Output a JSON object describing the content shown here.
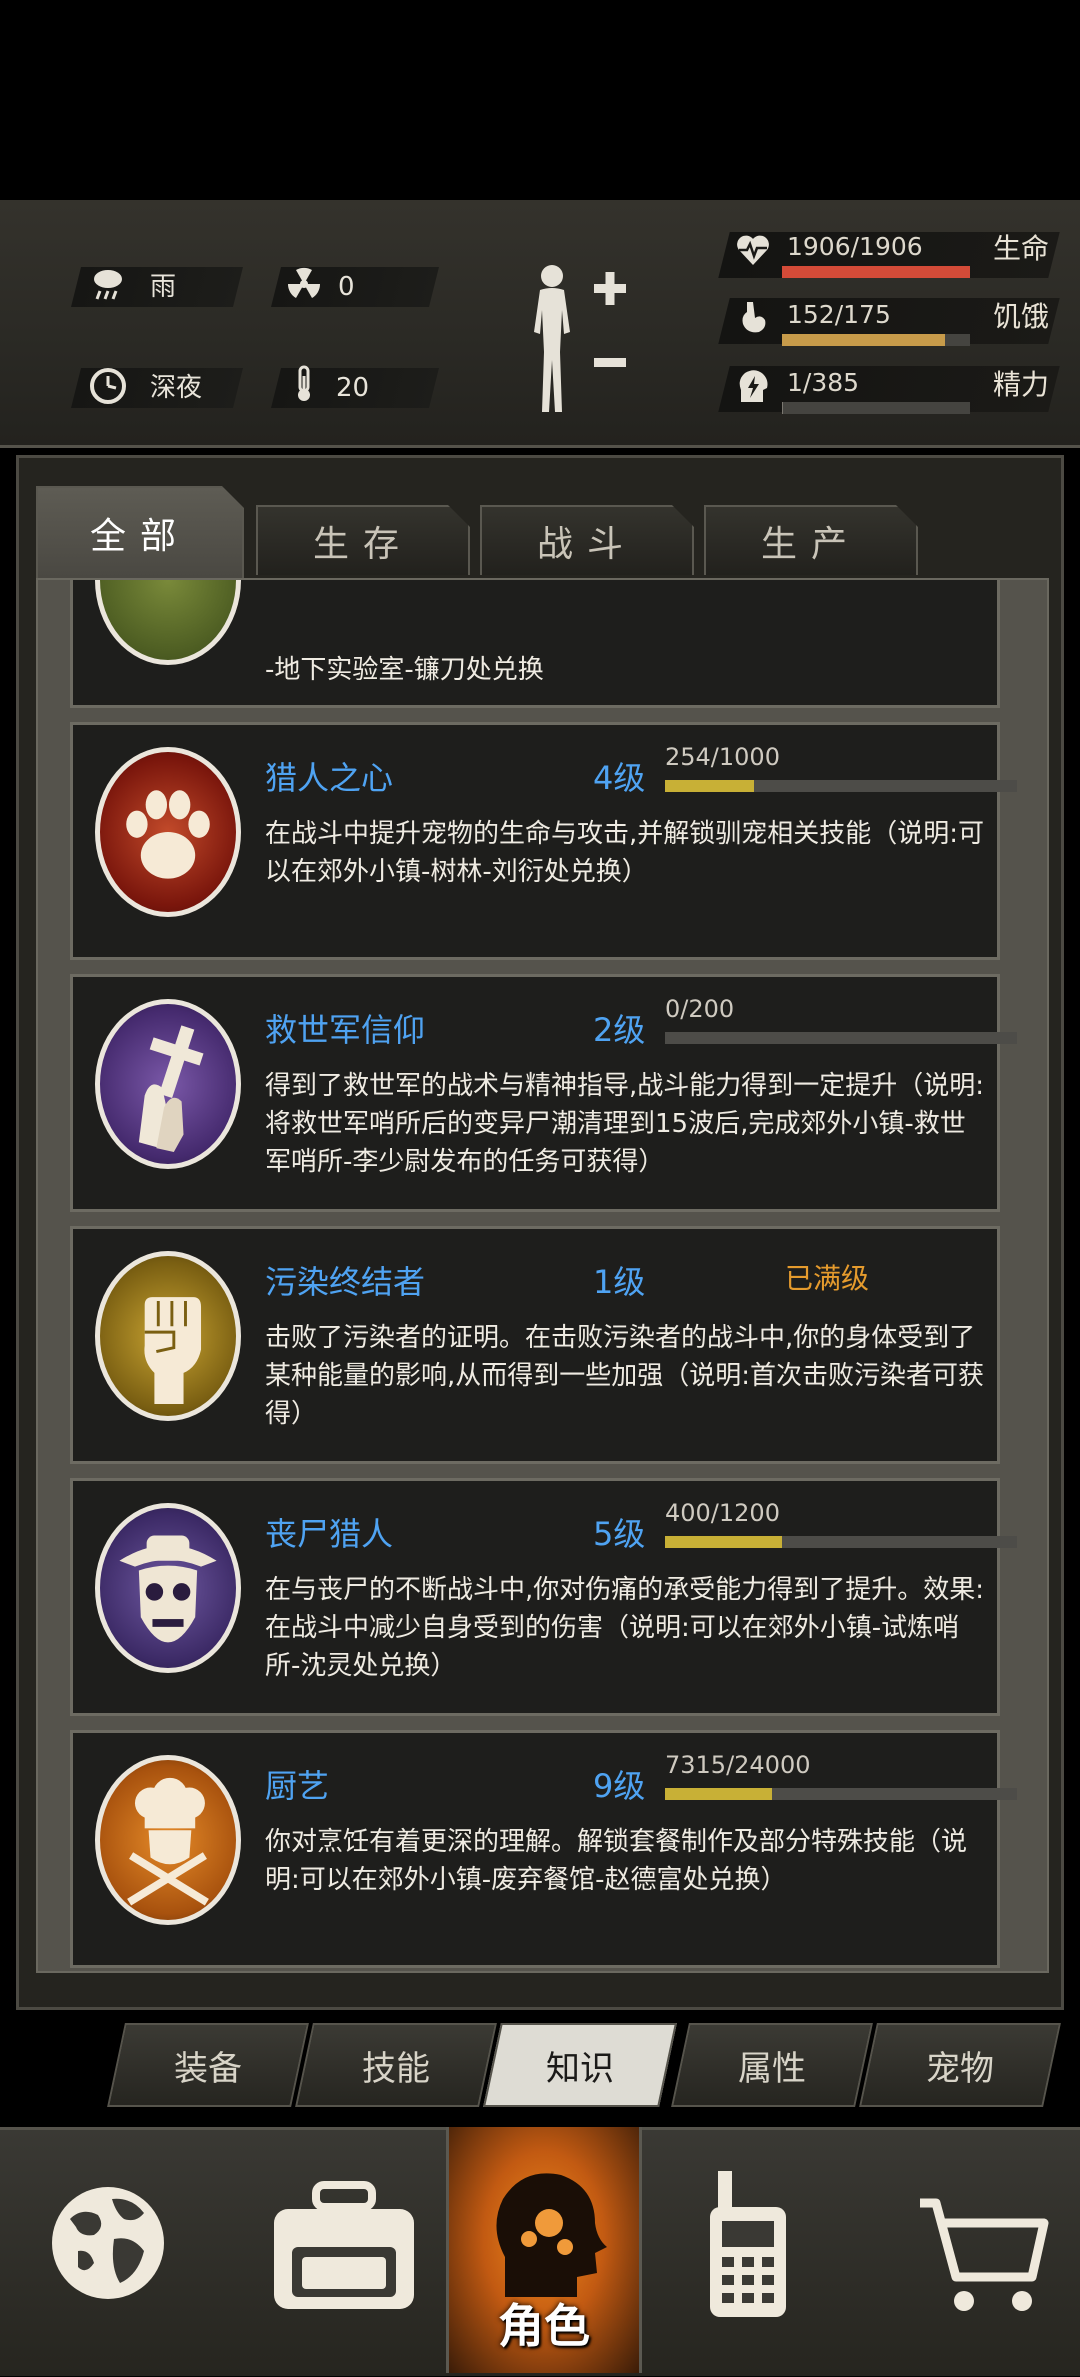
{
  "status": {
    "weather": "雨",
    "radiation": "0",
    "time_of_day": "深夜",
    "temperature": "20",
    "health": {
      "label": "生命",
      "text": "1906/1906",
      "fraction": 1.0,
      "color": "#d44b38"
    },
    "hunger": {
      "label": "饥饿",
      "text": "152/175",
      "fraction": 0.8686,
      "color": "#c79b4a"
    },
    "energy": {
      "label": "精力",
      "text": "1/385",
      "fraction": 0.0026,
      "color": "#7a7770"
    }
  },
  "tabs": [
    {
      "label": "全部",
      "active": true
    },
    {
      "label": "生存",
      "active": false
    },
    {
      "label": "战斗",
      "active": false
    },
    {
      "label": "生产",
      "active": false
    }
  ],
  "partial_card": {
    "desc_line": "-地下实验室-镰刀处兑换"
  },
  "skills": [
    {
      "name": "猎人之心",
      "level": "4级",
      "progress_text": "254/1000",
      "fraction": 0.254,
      "max_label": "",
      "desc": "在战斗中提升宠物的生命与攻击,并解锁驯宠相关技能（说明:可以在郊外小镇-树林-刘衍处兑换）",
      "icon": "paw-icon"
    },
    {
      "name": "救世军信仰",
      "level": "2级",
      "progress_text": "0/200",
      "fraction": 0.0,
      "max_label": "",
      "desc": "得到了救世军的战术与精神指导,战斗能力得到一定提升（说明:将救世军哨所后的变异尸潮清理到15波后,完成郊外小镇-救世军哨所-李少尉发布的任务可获得）",
      "icon": "praying-cross-icon"
    },
    {
      "name": "污染终结者",
      "level": "1级",
      "progress_text": "",
      "fraction": null,
      "max_label": "已满级",
      "desc": "击败了污染者的证明。在击败污染者的战斗中,你的身体受到了某种能量的影响,从而得到一些加强（说明:首次击败污染者可获得）",
      "icon": "fist-icon"
    },
    {
      "name": "丧尸猎人",
      "level": "5级",
      "progress_text": "400/1200",
      "fraction": 0.333,
      "max_label": "",
      "desc": "在与丧尸的不断战斗中,你对伤痛的承受能力得到了提升。效果:在战斗中减少自身受到的伤害（说明:可以在郊外小镇-试炼哨所-沈灵处兑换）",
      "icon": "zombie-skull-icon"
    },
    {
      "name": "厨艺",
      "level": "9级",
      "progress_text": "7315/24000",
      "fraction": 0.3048,
      "max_label": "",
      "desc": "你对烹饪有着更深的理解。解锁套餐制作及部分特殊技能（说明:可以在郊外小镇-废弃餐馆-赵德富处兑换）",
      "icon": "chef-icon"
    }
  ],
  "sub_tabs": [
    {
      "label": "装备",
      "active": false
    },
    {
      "label": "技能",
      "active": false
    },
    {
      "label": "知识",
      "active": true
    },
    {
      "label": "属性",
      "active": false
    },
    {
      "label": "宠物",
      "active": false
    }
  ],
  "bottom_nav": {
    "items": [
      "globe-icon",
      "backpack-icon",
      "character-icon",
      "radio-icon",
      "cart-icon"
    ],
    "active_label": "角色"
  }
}
